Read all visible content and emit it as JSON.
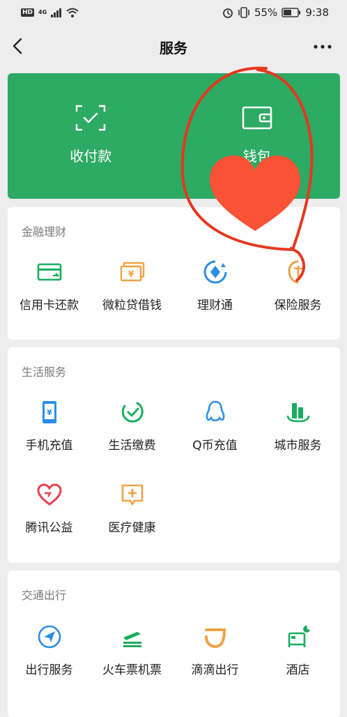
{
  "status_bar": {
    "hd": "HD",
    "network": "4G",
    "battery": "55%",
    "time": "9:38"
  },
  "nav": {
    "title": "服务",
    "back_icon": "chevron-left-icon",
    "more_icon": "more-dots-icon"
  },
  "top_card": {
    "color": "#2daa63",
    "items": [
      {
        "label": "收付款",
        "icon": "scan-check-icon"
      },
      {
        "label": "钱包",
        "icon": "wallet-icon"
      }
    ]
  },
  "sections": [
    {
      "title": "金融理财",
      "items": [
        {
          "label": "信用卡还款",
          "icon": "credit-card-icon"
        },
        {
          "label": "微粒贷借钱",
          "icon": "cash-icon"
        },
        {
          "label": "理财通",
          "icon": "wealth-icon"
        },
        {
          "label": "保险服务",
          "icon": "insurance-icon"
        }
      ]
    },
    {
      "title": "生活服务",
      "items": [
        {
          "label": "手机充值",
          "icon": "phone-topup-icon"
        },
        {
          "label": "生活缴费",
          "icon": "utility-payment-icon"
        },
        {
          "label": "Q币充值",
          "icon": "qq-penguin-icon"
        },
        {
          "label": "城市服务",
          "icon": "city-building-icon"
        },
        {
          "label": "腾讯公益",
          "icon": "charity-heart-icon"
        },
        {
          "label": "医疗健康",
          "icon": "medical-icon"
        }
      ]
    },
    {
      "title": "交通出行",
      "items": [
        {
          "label": "出行服务",
          "icon": "navigation-icon"
        },
        {
          "label": "火车票机票",
          "icon": "train-icon"
        },
        {
          "label": "滴滴出行",
          "icon": "didi-icon"
        },
        {
          "label": "酒店",
          "icon": "hotel-bed-icon"
        }
      ]
    }
  ],
  "annotations": {
    "circle_color": "#e5381f",
    "heart_color": "#fa5235"
  }
}
